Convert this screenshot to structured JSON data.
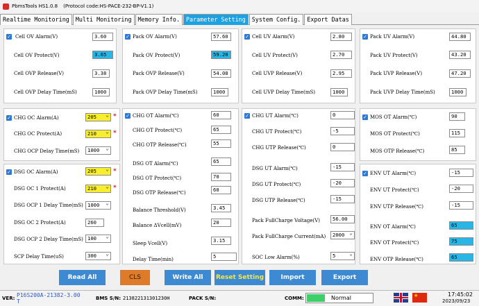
{
  "window": {
    "app": "PbmsTools HS1.0.8",
    "protocol": "(Protocol code:HS-PACE-232-BP-V1.1)"
  },
  "tabs": [
    "Realtime Monitoring",
    "Multi Monitoring",
    "Memory Info.",
    "Parameter Setting",
    "System Config.",
    "Export Datas"
  ],
  "p1": {
    "items": [
      {
        "label": "Cell OV Alarm(V)",
        "value": "3.60"
      },
      {
        "label": "Cell OV Protect(V)",
        "value": "3.65"
      },
      {
        "label": "Cell OVP Release(V)",
        "value": "3.38"
      },
      {
        "label": "Cell OVP Delay Time(mS)",
        "value": "1000"
      }
    ]
  },
  "p2": {
    "items": [
      {
        "label": "Pack OV Alarm(V)",
        "value": "57.60"
      },
      {
        "label": "Pack OV Protect(V)",
        "value": "59.20"
      },
      {
        "label": "Pack OVP Release(V)",
        "value": "54.08"
      },
      {
        "label": "Pack OVP Delay Time(mS)",
        "value": "1000"
      }
    ]
  },
  "p3": {
    "items": [
      {
        "label": "Cell UV Alarm(V)",
        "value": "2.80"
      },
      {
        "label": "Cell UV Protect(V)",
        "value": "2.70"
      },
      {
        "label": "Cell UVP Release(V)",
        "value": "2.95"
      },
      {
        "label": "Cell UVP Delay Time(mS)",
        "value": "1000"
      }
    ]
  },
  "p4": {
    "items": [
      {
        "label": "Pack UV Alarm(V)",
        "value": "44.80"
      },
      {
        "label": "Pack UV Protect(V)",
        "value": "43.20"
      },
      {
        "label": "Pack UVP Release(V)",
        "value": "47.20"
      },
      {
        "label": "Pack UVP Delay Time(mS)",
        "value": "1000"
      }
    ]
  },
  "p5": {
    "items": [
      {
        "label": "CHG OC Alarm(A)",
        "value": "205"
      },
      {
        "label": "CHG OC Protect(A)",
        "value": "210"
      },
      {
        "label": "CHG OCP Delay Time(mS)",
        "value": "1000"
      }
    ]
  },
  "p6": {
    "items": [
      {
        "label": "DSG OC Alarm(A)",
        "value": "205"
      },
      {
        "label": "DSG OC 1 Protect(A)",
        "value": "210"
      },
      {
        "label": "DSG OCP 1 Delay Time(mS)",
        "value": "1000"
      },
      {
        "label": "DSG OC 2 Protect(A)",
        "value": "260"
      },
      {
        "label": "DSG OCP 2 Delay Time(mS)",
        "value": "100"
      },
      {
        "label": "SCP Delay Time(uS)",
        "value": "300"
      }
    ]
  },
  "p7": {
    "items": [
      {
        "label": "CHG OT Alarm(℃)",
        "value": "60"
      },
      {
        "label": "CHG OT Protect(℃)",
        "value": "65"
      },
      {
        "label": "CHG OTP Release(℃)",
        "value": "55"
      },
      {
        "label": "DSG OT Alarm(℃)",
        "value": "65"
      },
      {
        "label": "DSG OT Protect(℃)",
        "value": "70"
      },
      {
        "label": "DSG OTP Release(℃)",
        "value": "60"
      },
      {
        "label": "Balance Threshold(V)",
        "value": "3.45"
      },
      {
        "label": "Balance ΔVcell(mV)",
        "value": "20"
      },
      {
        "label": "Sleep Vcell(V)",
        "value": "3.15"
      },
      {
        "label": "Delay Time(min)",
        "value": "5"
      }
    ]
  },
  "p8": {
    "items": [
      {
        "label": "CHG UT Alarm(℃)",
        "value": "0"
      },
      {
        "label": "CHG UT Protect(℃)",
        "value": "-5"
      },
      {
        "label": "CHG UTP Release(℃)",
        "value": "0"
      },
      {
        "label": "DSG UT Alarm(℃)",
        "value": "-15"
      },
      {
        "label": "DSG UT Protect(℃)",
        "value": "-20"
      },
      {
        "label": "DSG UTP Release(℃)",
        "value": "-15"
      },
      {
        "label": "Pack FullCharge Voltage(V)",
        "value": "56.00"
      },
      {
        "label": "Pack FullCharge Current(mA)",
        "value": "2000"
      },
      {
        "label": "SOC Low Alarm(%)",
        "value": "5"
      }
    ]
  },
  "p9": {
    "items": [
      {
        "label": "MOS OT Alarm(℃)",
        "value": "90"
      },
      {
        "label": "MOS OT Protect(℃)",
        "value": "115"
      },
      {
        "label": "MOS OTP Release(℃)",
        "value": "85"
      }
    ]
  },
  "p10": {
    "items": [
      {
        "label": "ENV UT Alarm(℃)",
        "value": "-15"
      },
      {
        "label": "ENV UT Protect(℃)",
        "value": "-20"
      },
      {
        "label": "ENV UTP Release(℃)",
        "value": "-15"
      },
      {
        "label": "ENV OT Alarm(℃)",
        "value": "65"
      },
      {
        "label": "ENV OT Protect(℃)",
        "value": "75"
      },
      {
        "label": "ENV OTP Release(℃)",
        "value": "65"
      }
    ]
  },
  "buttons": {
    "read": "Read All",
    "cls": "CLS",
    "write": "Write All",
    "reset": "Reset Setting",
    "import": "Import",
    "export": "Export"
  },
  "status": {
    "ver_label": "VER:",
    "ver": "P16S200A-21382-3.00",
    "ver2": "T",
    "bms_label": "BMS S/N:",
    "bms": "213822131301230H",
    "pack_label": "PACK S/N:",
    "comm_label": "COMM:",
    "comm": "Normal",
    "time": "17:45:02",
    "date": "2023/09/23"
  },
  "colors": {
    "accent": "#1ea1e0",
    "button": "#3d8ad2",
    "cls": "#dd7b2a",
    "highlight_yellow": "#f8ee2f",
    "highlight_blue": "#28b6e6",
    "comm_ok": "#3fcf6a"
  }
}
